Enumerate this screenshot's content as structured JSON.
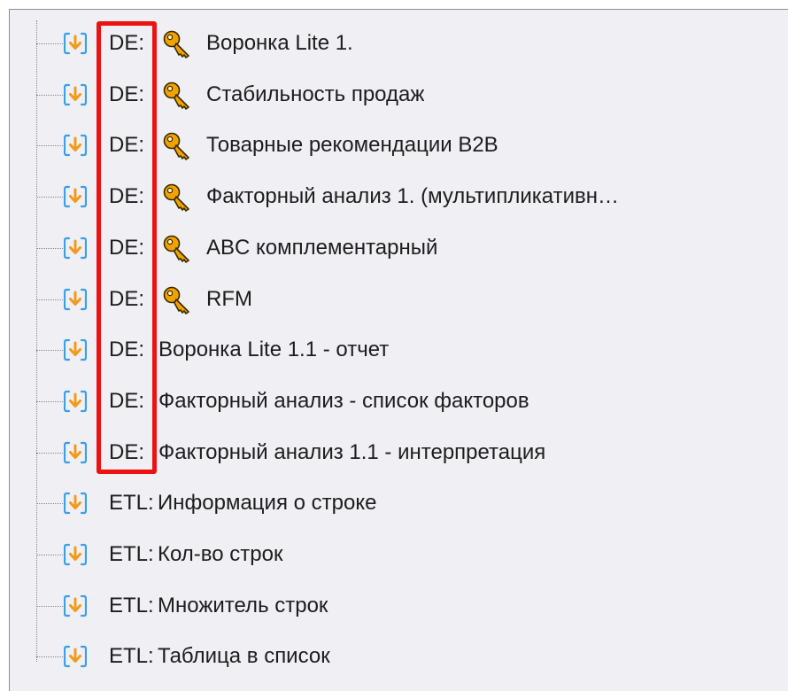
{
  "tree": {
    "items": [
      {
        "prefix": "DE:",
        "has_key": true,
        "label": "Воронка Lite 1."
      },
      {
        "prefix": "DE:",
        "has_key": true,
        "label": "Стабильность продаж"
      },
      {
        "prefix": "DE:",
        "has_key": true,
        "label": "Товарные рекомендации B2B"
      },
      {
        "prefix": "DE:",
        "has_key": true,
        "label": "Факторный анализ 1. (мультипликативн…"
      },
      {
        "prefix": "DE:",
        "has_key": true,
        "label": "ABC комплементарный"
      },
      {
        "prefix": "DE:",
        "has_key": true,
        "label": "RFM"
      },
      {
        "prefix": "DE:",
        "has_key": false,
        "label": "Воронка Lite 1.1 - отчет"
      },
      {
        "prefix": "DE:",
        "has_key": false,
        "label": "Факторный анализ - список факторов"
      },
      {
        "prefix": "DE:",
        "has_key": false,
        "label": "Факторный анализ 1.1 - интерпретация"
      },
      {
        "prefix": "ETL:",
        "has_key": false,
        "label": "Информация о строке"
      },
      {
        "prefix": "ETL:",
        "has_key": false,
        "label": "Кол-во строк"
      },
      {
        "prefix": "ETL:",
        "has_key": false,
        "label": "Множитель строк"
      },
      {
        "prefix": "ETL:",
        "has_key": false,
        "label": "Таблица в список"
      }
    ]
  },
  "icons": {
    "node": "download-arrow-icon",
    "key": "key-icon"
  },
  "colors": {
    "background": "#efeff4",
    "highlight": "#ee1111",
    "node_icon_ring": "#3aa0e8",
    "node_icon_arrow": "#f29a1c",
    "key": "#f0a300"
  }
}
